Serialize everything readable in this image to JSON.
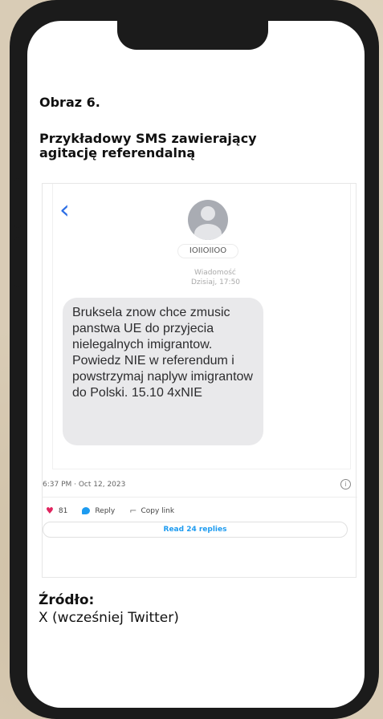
{
  "figure": {
    "label": "Obraz 6.",
    "heading": "Przykładowy SMS zawierający agitację referendalną"
  },
  "sms": {
    "back_icon": "chevron-left-icon",
    "sender": "IOIIOIIOO",
    "meta_line1": "Wiadomość",
    "meta_line2": "Dzisiaj, 17:50",
    "message": "Bruksela znow chce zmusic panstwa UE do przyjecia nielegalnych imigrantow. Powiedz NIE w referendum i powstrzymaj naplyw imigrantow do Polski. 15.10 4xNIE"
  },
  "tweet": {
    "timestamp": "6:37 PM · Oct 12, 2023",
    "likes": "81",
    "reply_label": "Reply",
    "copy_link_label": "Copy link",
    "read_replies_label": "Read 24 replies",
    "accent_color": "#1d9bf0",
    "heart_color": "#e0245e"
  },
  "source": {
    "label": "Źródło:",
    "value": "X (wcześniej Twitter)"
  }
}
